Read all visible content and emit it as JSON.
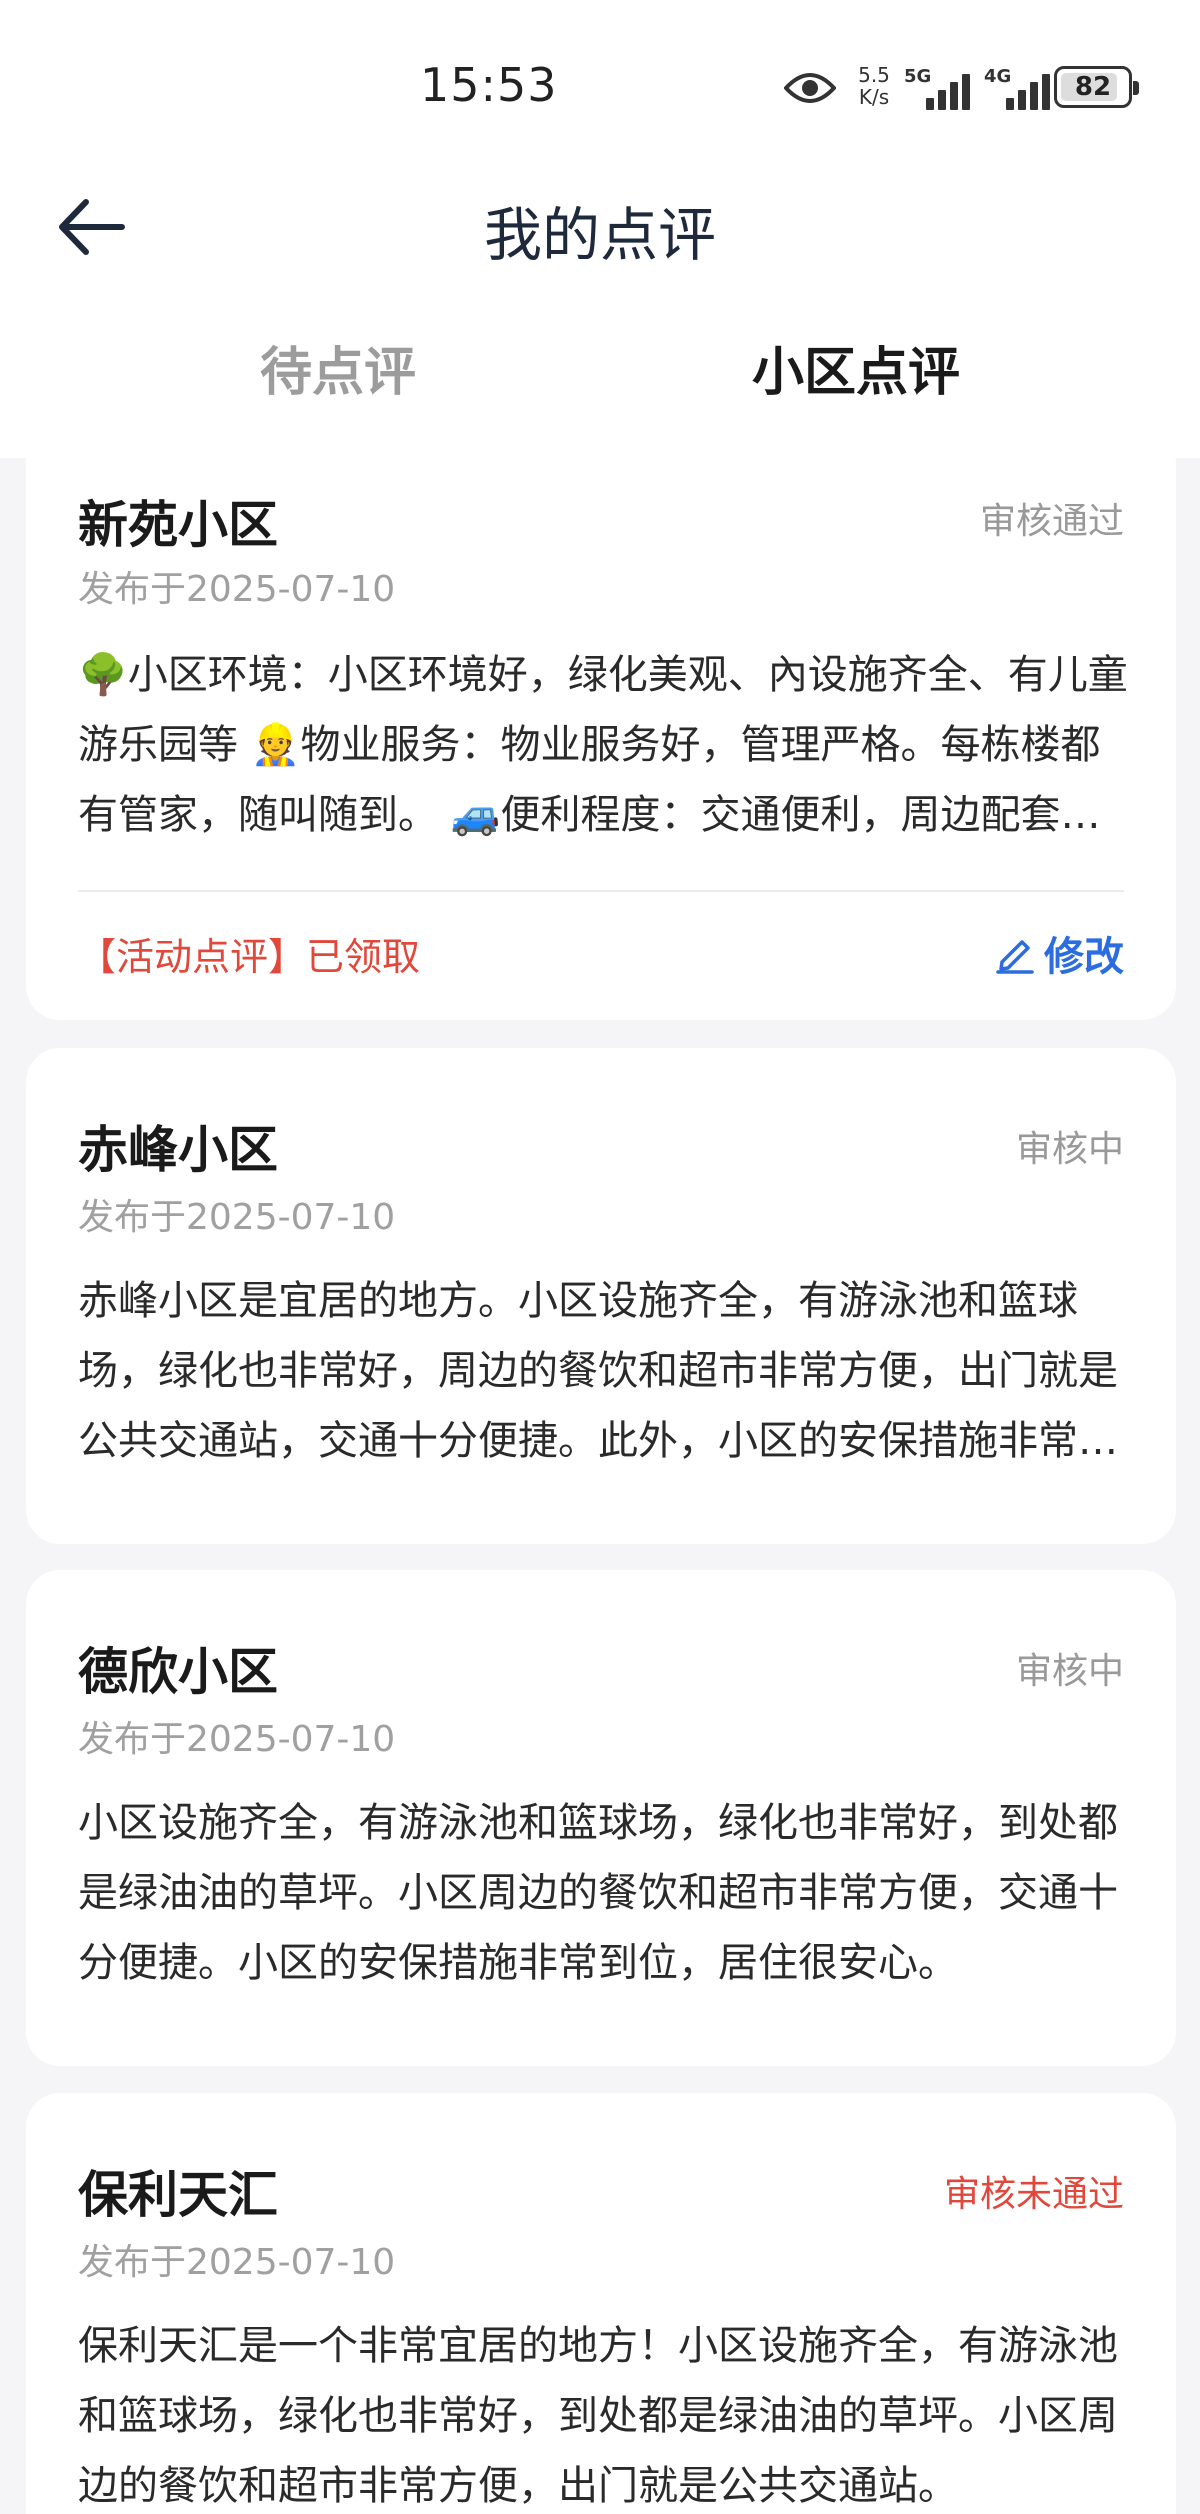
{
  "status_bar": {
    "time": "15:53",
    "net_speed_top": "5.5",
    "net_speed_bottom": "K/s",
    "sim1": "5G",
    "sim2": "4G",
    "battery": "82"
  },
  "header": {
    "title": "我的点评"
  },
  "tabs": [
    {
      "label": "待点评",
      "active": false
    },
    {
      "label": "小区点评",
      "active": true
    }
  ],
  "reviews": [
    {
      "name": "新苑小区",
      "status": "审核通过",
      "date": "发布于2025-07-10",
      "text": "🌳小区环境：小区环境好，绿化美观、內设施齐全、有儿童游乐园等 👷物业服务：物业服务好，管理严格。每栋楼都有管家，随叫随到。 🚙便利程度：交通便利，周边配套齐全。",
      "reward": "【活动点评】已领取",
      "edit_label": "修改"
    },
    {
      "name": "赤峰小区",
      "status": "审核中",
      "date": "发布于2025-07-10",
      "text": "赤峰小区是宜居的地方。小区设施齐全，有游泳池和篮球场，绿化也非常好，周边的餐饮和超市非常方便，出门就是公共交通站，交通十分便捷。此外，小区的安保措施非常到位。"
    },
    {
      "name": "德欣小区",
      "status": "审核中",
      "date": "发布于2025-07-10",
      "text": "小区设施齐全，有游泳池和篮球场，绿化也非常好，到处都是绿油油的草坪。小区周边的餐饮和超市非常方便，交通十分便捷。小区的安保措施非常到位，居住很安心。"
    },
    {
      "name": "保利天汇",
      "status": "审核未通过",
      "date": "发布于2025-07-10",
      "text": "保利天汇是一个非常宜居的地方！小区设施齐全，有游泳池和篮球场，绿化也非常好，到处都是绿油油的草坪。小区周边的餐饮和超市非常方便，出门就是公共交通站。"
    }
  ],
  "colors": {
    "accent_blue": "#2b6de0",
    "status_fail": "#e0483c",
    "background": "#f5f5f7"
  }
}
